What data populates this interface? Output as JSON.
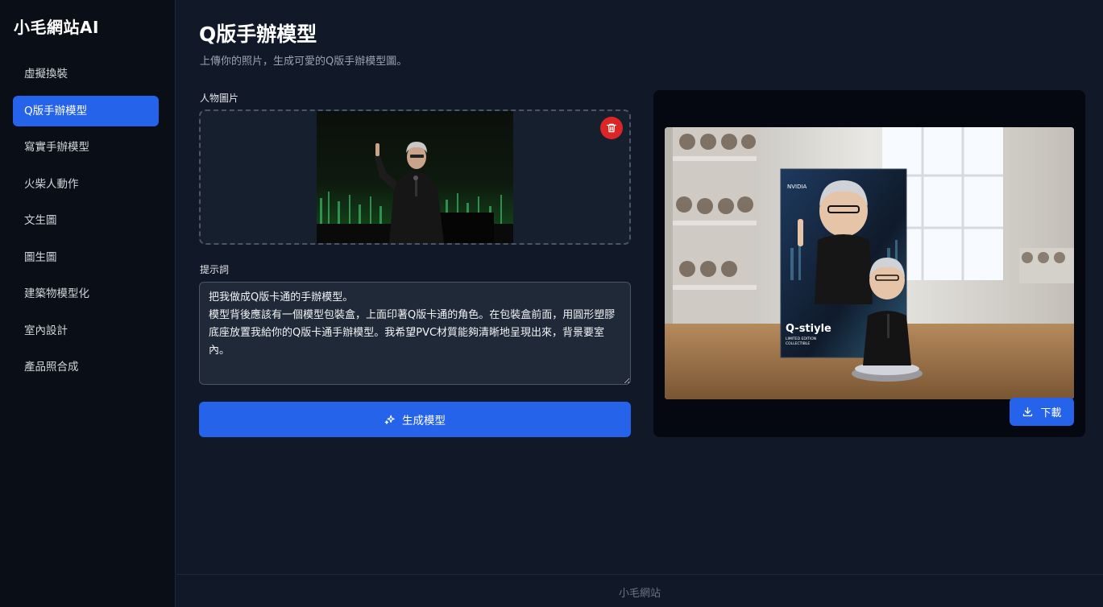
{
  "sidebar": {
    "brand": "小毛網站AI",
    "items": [
      {
        "label": "虛擬換裝"
      },
      {
        "label": "Q版手辦模型"
      },
      {
        "label": "寫實手辦模型"
      },
      {
        "label": "火柴人動作"
      },
      {
        "label": "文生圖"
      },
      {
        "label": "圖生圖"
      },
      {
        "label": "建築物模型化"
      },
      {
        "label": "室內設計"
      },
      {
        "label": "產品照合成"
      }
    ],
    "active_index": 1
  },
  "main": {
    "title": "Q版手辦模型",
    "subtitle": "上傳你的照片，生成可愛的Q版手辦模型圖。",
    "image_label": "人物圖片",
    "prompt_label": "提示詞",
    "prompt_value": "把我做成Q版卡通的手辦模型。\n模型背後應該有一個模型包裝盒，上面印著Q版卡通的角色。在包裝盒前面，用圓形塑膠底座放置我給你的Q版卡通手辦模型。我希望PVC材質能夠清晰地呈現出來，背景要室內。",
    "generate_label": "生成模型",
    "download_label": "下載"
  },
  "result_box_text": {
    "brand": "NVIDIA",
    "title": "Q-stiyle",
    "edition": "LIMITED EDITION",
    "sub": "COLLECTIBLE"
  },
  "footer": {
    "text": "小毛網站"
  },
  "colors": {
    "accent": "#2563eb",
    "danger": "#dc2626",
    "background": "#111827",
    "sidebar": "#0a0e17"
  },
  "icons": {
    "delete": "trash-icon",
    "generate": "sparkles-icon",
    "download": "download-icon"
  }
}
